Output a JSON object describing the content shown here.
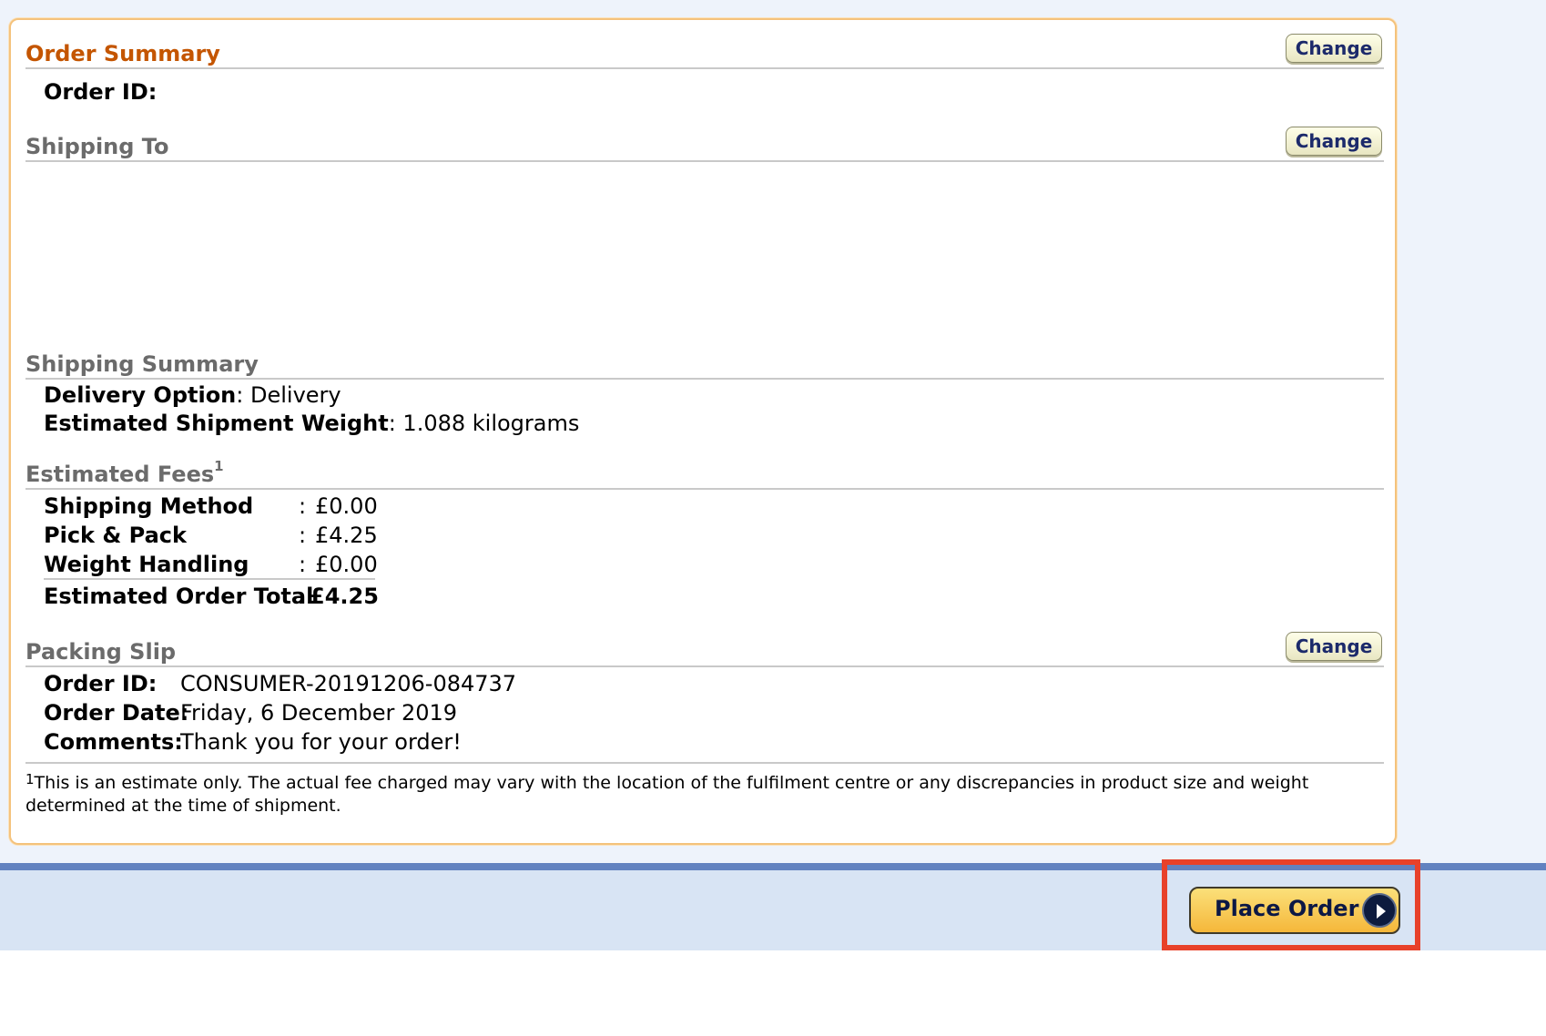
{
  "order_summary": {
    "title": "Order Summary",
    "change_label": "Change",
    "order_id_label": "Order ID:"
  },
  "shipping_to": {
    "title": "Shipping To",
    "change_label": "Change"
  },
  "shipping_summary": {
    "title": "Shipping Summary",
    "delivery_option_label": "Delivery Option",
    "delivery_option_value": ": Delivery",
    "weight_label": "Estimated Shipment Weight",
    "weight_value": ": 1.088 kilograms"
  },
  "estimated_fees": {
    "title": "Estimated Fees",
    "footnote_marker": "1",
    "rows": [
      {
        "label": "Shipping Method",
        "colon": ":",
        "value": "£0.00"
      },
      {
        "label": "Pick & Pack",
        "colon": ":",
        "value": "£4.25"
      },
      {
        "label": "Weight Handling",
        "colon": ":",
        "value": "£0.00"
      }
    ],
    "total": {
      "label": "Estimated Order Total",
      "colon": ":",
      "value": "£4.25"
    }
  },
  "packing_slip": {
    "title": "Packing Slip",
    "change_label": "Change",
    "order_id_label": "Order ID:",
    "order_id_value": "CONSUMER-20191206-084737",
    "order_date_label": "Order Date:",
    "order_date_value": "Friday, 6 December 2019",
    "comments_label": "Comments:",
    "comments_value": "Thank you for your order!"
  },
  "footnote": {
    "marker": "1",
    "text": "This is an estimate only. The actual fee charged may vary with the location of the fulfilment centre or any discrepancies in product size and weight determined at the time of shipment."
  },
  "actions": {
    "place_order_label": "Place Order"
  },
  "colors": {
    "section_title_accent": "#c45500",
    "panel_border": "#f4c27c",
    "highlight_border": "#e8412a",
    "bottom_bar": "#d8e4f4"
  }
}
